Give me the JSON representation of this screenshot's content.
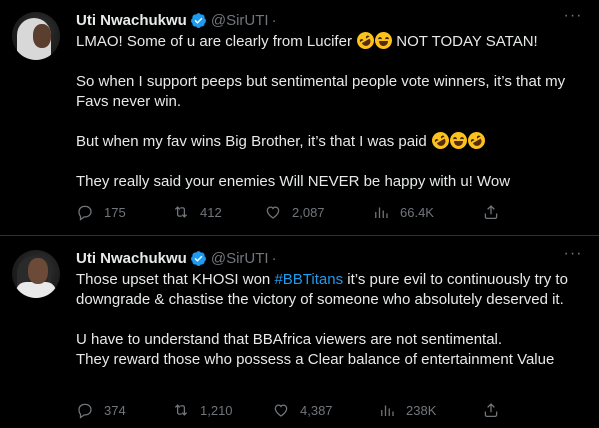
{
  "tweets": [
    {
      "author": {
        "name": "Uti Nwachukwu",
        "handle": "@SirUTI",
        "separator": "·"
      },
      "body": {
        "p1_text": "LMAO! Some of u are clearly from Lucifer ",
        "p1_tail": " NOT TODAY SATAN!",
        "p2": "So when I support peeps but sentimental people vote winners, it’s that my Favs never win.",
        "p3": "But when my fav wins Big Brother, it’s that I was paid ",
        "p4": "They really said your enemies Will NEVER be happy with u! Wow"
      },
      "stats": {
        "replies": "175",
        "retweets": "412",
        "likes": "2,087",
        "views": "66.4K"
      }
    },
    {
      "author": {
        "name": "Uti Nwachukwu",
        "handle": "@SirUTI",
        "separator": "·"
      },
      "body": {
        "p1_a": "Those upset that KHOSI won ",
        "p1_hashtag": "#BBTitans",
        "p1_b": " it’s pure evil to continuously try to downgrade & chastise the victory of someone who absolutely deserved it.",
        "p2": "U have to understand that BBAfrica viewers are not sentimental.",
        "p3": "They reward those who possess a Clear balance of entertainment Value"
      },
      "stats": {
        "replies": "374",
        "retweets": "1,210",
        "likes": "4,387",
        "views": "238K"
      }
    }
  ],
  "icons": {
    "more": "more-dots-icon",
    "verified": "verified-badge-icon",
    "reply": "reply-icon",
    "retweet": "retweet-icon",
    "like": "like-icon",
    "views": "views-icon",
    "share": "share-icon"
  },
  "colors": {
    "background": "#000000",
    "text": "#e7e9ea",
    "muted": "#71767b",
    "accent": "#1d9bf0",
    "divider": "#2f3336"
  }
}
